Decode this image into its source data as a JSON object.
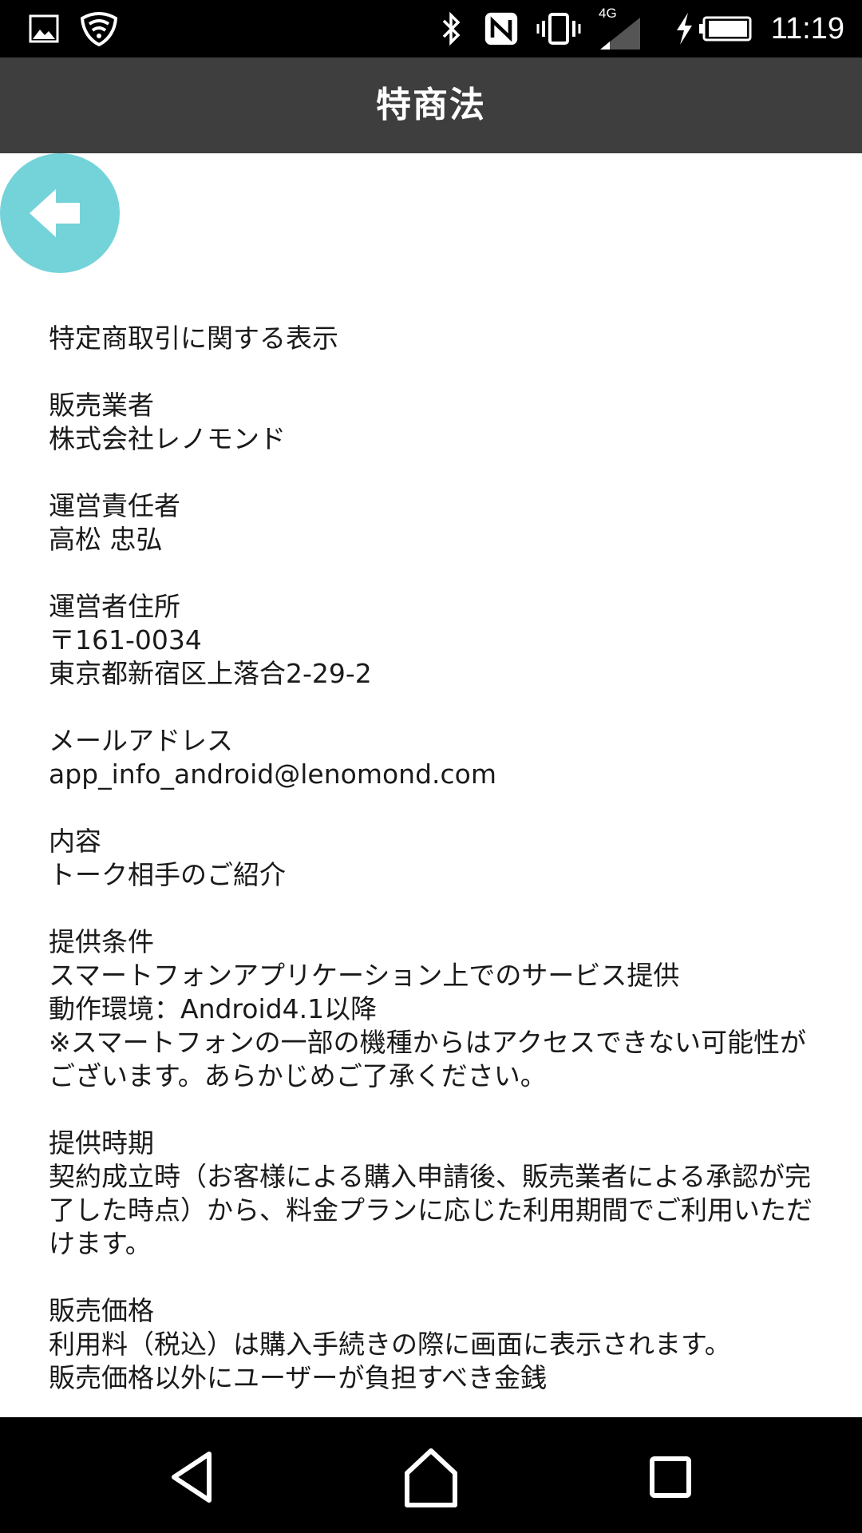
{
  "status_bar": {
    "time": "11:19",
    "network": "4G",
    "icons": [
      "gallery-icon",
      "shield-icon",
      "bluetooth-icon",
      "nfc-icon",
      "vibrate-icon",
      "signal-icon",
      "charging-icon",
      "battery-icon"
    ]
  },
  "app_bar": {
    "title": "特商法"
  },
  "back_button": {
    "icon": "arrow-left-icon",
    "color": "#74d3d9"
  },
  "content": {
    "heading": "特定商取引に関する表示",
    "sections": [
      {
        "label": "販売業者",
        "lines": [
          "株式会社レノモンド"
        ]
      },
      {
        "label": "運営責任者",
        "lines": [
          "高松 忠弘"
        ]
      },
      {
        "label": "運営者住所",
        "lines": [
          "〒161-0034",
          "東京都新宿区上落合2-29-2"
        ]
      },
      {
        "label": "メールアドレス",
        "lines": [
          "app_info_android@lenomond.com"
        ]
      },
      {
        "label": "内容",
        "lines": [
          "トーク相手のご紹介"
        ]
      },
      {
        "label": "提供条件",
        "lines": [
          "スマートフォンアプリケーション上でのサービス提供",
          "動作環境：Android4.1以降",
          "※スマートフォンの一部の機種からはアクセスできない可能性がございます。あらかじめご了承ください。"
        ]
      },
      {
        "label": "提供時期",
        "lines": [
          "契約成立時（お客様による購入申請後、販売業者による承認が完了した時点）から、料金プランに応じた利用期間でご利用いただけます。"
        ]
      },
      {
        "label": "販売価格",
        "lines": [
          "利用料（税込）は購入手続きの際に画面に表示されます。",
          "販売価格以外にユーザーが負担すべき金銭"
        ]
      }
    ]
  },
  "nav_bar": {
    "buttons": [
      "back-nav-icon",
      "home-nav-icon",
      "recents-nav-icon"
    ]
  }
}
